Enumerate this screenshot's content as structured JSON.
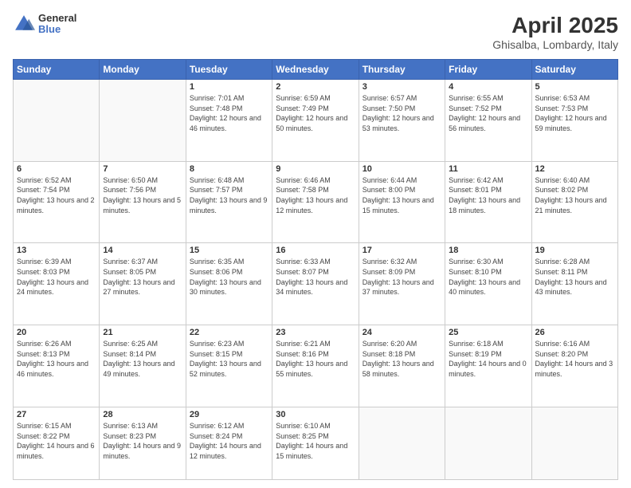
{
  "header": {
    "logo_line1": "General",
    "logo_line2": "Blue",
    "title": "April 2025",
    "subtitle": "Ghisalba, Lombardy, Italy"
  },
  "days_of_week": [
    "Sunday",
    "Monday",
    "Tuesday",
    "Wednesday",
    "Thursday",
    "Friday",
    "Saturday"
  ],
  "weeks": [
    [
      {
        "day": "",
        "info": ""
      },
      {
        "day": "",
        "info": ""
      },
      {
        "day": "1",
        "info": "Sunrise: 7:01 AM\nSunset: 7:48 PM\nDaylight: 12 hours and 46 minutes."
      },
      {
        "day": "2",
        "info": "Sunrise: 6:59 AM\nSunset: 7:49 PM\nDaylight: 12 hours and 50 minutes."
      },
      {
        "day": "3",
        "info": "Sunrise: 6:57 AM\nSunset: 7:50 PM\nDaylight: 12 hours and 53 minutes."
      },
      {
        "day": "4",
        "info": "Sunrise: 6:55 AM\nSunset: 7:52 PM\nDaylight: 12 hours and 56 minutes."
      },
      {
        "day": "5",
        "info": "Sunrise: 6:53 AM\nSunset: 7:53 PM\nDaylight: 12 hours and 59 minutes."
      }
    ],
    [
      {
        "day": "6",
        "info": "Sunrise: 6:52 AM\nSunset: 7:54 PM\nDaylight: 13 hours and 2 minutes."
      },
      {
        "day": "7",
        "info": "Sunrise: 6:50 AM\nSunset: 7:56 PM\nDaylight: 13 hours and 5 minutes."
      },
      {
        "day": "8",
        "info": "Sunrise: 6:48 AM\nSunset: 7:57 PM\nDaylight: 13 hours and 9 minutes."
      },
      {
        "day": "9",
        "info": "Sunrise: 6:46 AM\nSunset: 7:58 PM\nDaylight: 13 hours and 12 minutes."
      },
      {
        "day": "10",
        "info": "Sunrise: 6:44 AM\nSunset: 8:00 PM\nDaylight: 13 hours and 15 minutes."
      },
      {
        "day": "11",
        "info": "Sunrise: 6:42 AM\nSunset: 8:01 PM\nDaylight: 13 hours and 18 minutes."
      },
      {
        "day": "12",
        "info": "Sunrise: 6:40 AM\nSunset: 8:02 PM\nDaylight: 13 hours and 21 minutes."
      }
    ],
    [
      {
        "day": "13",
        "info": "Sunrise: 6:39 AM\nSunset: 8:03 PM\nDaylight: 13 hours and 24 minutes."
      },
      {
        "day": "14",
        "info": "Sunrise: 6:37 AM\nSunset: 8:05 PM\nDaylight: 13 hours and 27 minutes."
      },
      {
        "day": "15",
        "info": "Sunrise: 6:35 AM\nSunset: 8:06 PM\nDaylight: 13 hours and 30 minutes."
      },
      {
        "day": "16",
        "info": "Sunrise: 6:33 AM\nSunset: 8:07 PM\nDaylight: 13 hours and 34 minutes."
      },
      {
        "day": "17",
        "info": "Sunrise: 6:32 AM\nSunset: 8:09 PM\nDaylight: 13 hours and 37 minutes."
      },
      {
        "day": "18",
        "info": "Sunrise: 6:30 AM\nSunset: 8:10 PM\nDaylight: 13 hours and 40 minutes."
      },
      {
        "day": "19",
        "info": "Sunrise: 6:28 AM\nSunset: 8:11 PM\nDaylight: 13 hours and 43 minutes."
      }
    ],
    [
      {
        "day": "20",
        "info": "Sunrise: 6:26 AM\nSunset: 8:13 PM\nDaylight: 13 hours and 46 minutes."
      },
      {
        "day": "21",
        "info": "Sunrise: 6:25 AM\nSunset: 8:14 PM\nDaylight: 13 hours and 49 minutes."
      },
      {
        "day": "22",
        "info": "Sunrise: 6:23 AM\nSunset: 8:15 PM\nDaylight: 13 hours and 52 minutes."
      },
      {
        "day": "23",
        "info": "Sunrise: 6:21 AM\nSunset: 8:16 PM\nDaylight: 13 hours and 55 minutes."
      },
      {
        "day": "24",
        "info": "Sunrise: 6:20 AM\nSunset: 8:18 PM\nDaylight: 13 hours and 58 minutes."
      },
      {
        "day": "25",
        "info": "Sunrise: 6:18 AM\nSunset: 8:19 PM\nDaylight: 14 hours and 0 minutes."
      },
      {
        "day": "26",
        "info": "Sunrise: 6:16 AM\nSunset: 8:20 PM\nDaylight: 14 hours and 3 minutes."
      }
    ],
    [
      {
        "day": "27",
        "info": "Sunrise: 6:15 AM\nSunset: 8:22 PM\nDaylight: 14 hours and 6 minutes."
      },
      {
        "day": "28",
        "info": "Sunrise: 6:13 AM\nSunset: 8:23 PM\nDaylight: 14 hours and 9 minutes."
      },
      {
        "day": "29",
        "info": "Sunrise: 6:12 AM\nSunset: 8:24 PM\nDaylight: 14 hours and 12 minutes."
      },
      {
        "day": "30",
        "info": "Sunrise: 6:10 AM\nSunset: 8:25 PM\nDaylight: 14 hours and 15 minutes."
      },
      {
        "day": "",
        "info": ""
      },
      {
        "day": "",
        "info": ""
      },
      {
        "day": "",
        "info": ""
      }
    ]
  ]
}
